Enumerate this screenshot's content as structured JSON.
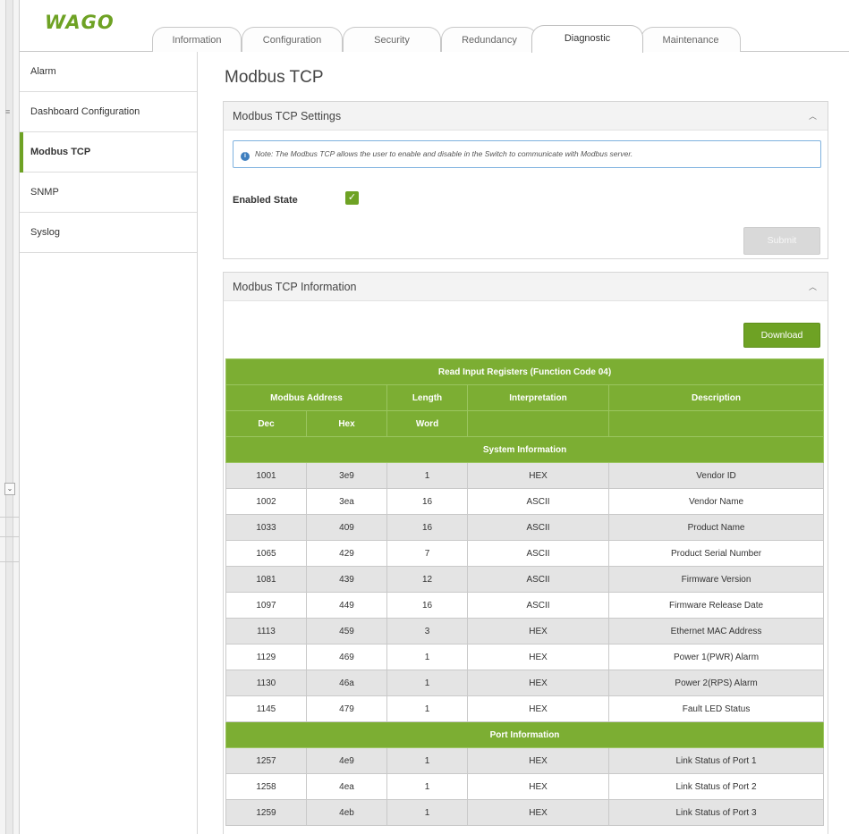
{
  "header": {
    "logo": "WAGO",
    "tabs": [
      {
        "label": "Information",
        "active": false
      },
      {
        "label": "Configuration",
        "active": false
      },
      {
        "label": "Security",
        "active": false
      },
      {
        "label": "Redundancy",
        "active": false
      },
      {
        "label": "Diagnostic",
        "active": true
      },
      {
        "label": "Maintenance",
        "active": false
      }
    ]
  },
  "sidebar": {
    "items": [
      {
        "label": "Alarm",
        "active": false
      },
      {
        "label": "Dashboard Configuration",
        "active": false
      },
      {
        "label": "Modbus TCP",
        "active": true
      },
      {
        "label": "SNMP",
        "active": false
      },
      {
        "label": "Syslog",
        "active": false
      }
    ]
  },
  "main": {
    "title": "Modbus TCP",
    "settings_panel": {
      "heading": "Modbus TCP Settings",
      "note": "Note: The Modbus TCP allows the user to enable and disable in the Switch to communicate with Modbus server.",
      "enabled_label": "Enabled State",
      "enabled": true,
      "submit_label": "Submit"
    },
    "info_panel": {
      "heading": "Modbus TCP Information",
      "download_label": "Download",
      "table": {
        "title": "Read Input Registers (Function Code 04)",
        "headers": {
          "modbus_address": "Modbus Address",
          "length": "Length",
          "interpretation": "Interpretation",
          "description": "Description",
          "dec": "Dec",
          "hex": "Hex",
          "word": "Word"
        },
        "sections": [
          {
            "title": "System Information",
            "rows": [
              [
                "1001",
                "3e9",
                "1",
                "HEX",
                "Vendor ID"
              ],
              [
                "1002",
                "3ea",
                "16",
                "ASCII",
                "Vendor Name"
              ],
              [
                "1033",
                "409",
                "16",
                "ASCII",
                "Product Name"
              ],
              [
                "1065",
                "429",
                "7",
                "ASCII",
                "Product Serial Number"
              ],
              [
                "1081",
                "439",
                "12",
                "ASCII",
                "Firmware Version"
              ],
              [
                "1097",
                "449",
                "16",
                "ASCII",
                "Firmware Release Date"
              ],
              [
                "1113",
                "459",
                "3",
                "HEX",
                "Ethernet MAC Address"
              ],
              [
                "1129",
                "469",
                "1",
                "HEX",
                "Power 1(PWR) Alarm"
              ],
              [
                "1130",
                "46a",
                "1",
                "HEX",
                "Power 2(RPS) Alarm"
              ],
              [
                "1145",
                "479",
                "1",
                "HEX",
                "Fault LED Status"
              ]
            ]
          },
          {
            "title": "Port Information",
            "rows": [
              [
                "1257",
                "4e9",
                "1",
                "HEX",
                "Link Status of Port 1"
              ],
              [
                "1258",
                "4ea",
                "1",
                "HEX",
                "Link Status of Port 2"
              ],
              [
                "1259",
                "4eb",
                "1",
                "HEX",
                "Link Status of Port 3"
              ]
            ]
          }
        ]
      }
    }
  },
  "colors": {
    "brand_green": "#6ea224",
    "table_green": "#7cae33",
    "info_blue": "#3f7fbf"
  }
}
